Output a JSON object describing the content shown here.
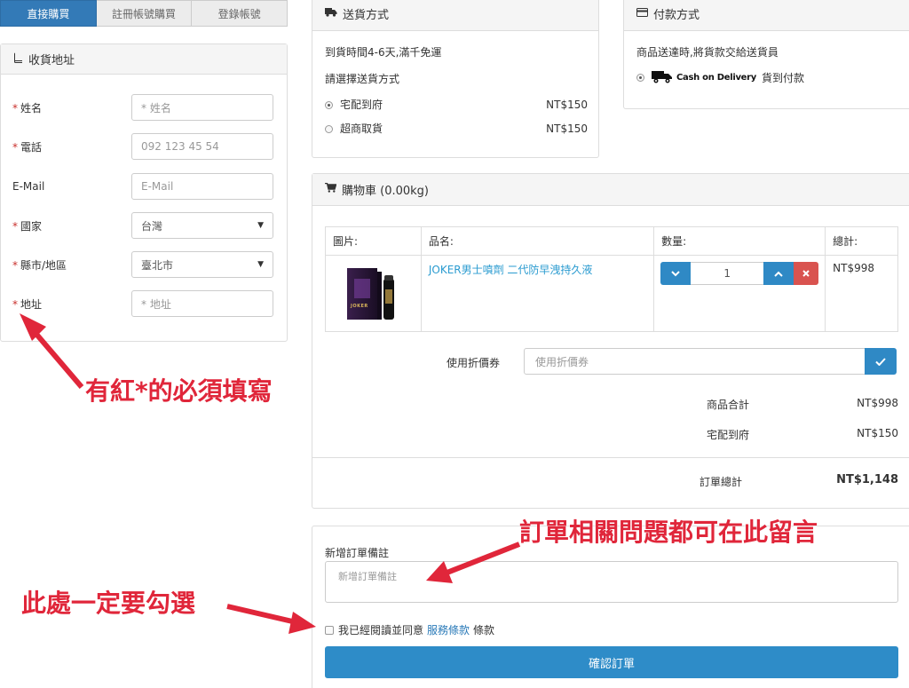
{
  "tabs": [
    {
      "label": "直接購買"
    },
    {
      "label": "註冊帳號購買"
    },
    {
      "label": "登錄帳號"
    }
  ],
  "address": {
    "title": "收貨地址",
    "fields": [
      {
        "label": "姓名",
        "required": true,
        "placeholder": "* 姓名"
      },
      {
        "label": "電話",
        "required": true,
        "placeholder": "092 123 45 54"
      },
      {
        "label": "E-Mail",
        "required": false,
        "placeholder": "E-Mail"
      },
      {
        "label": "國家",
        "required": true,
        "value": "台灣"
      },
      {
        "label": "縣市/地區",
        "required": true,
        "value": "臺北市"
      },
      {
        "label": "地址",
        "required": true,
        "placeholder": "* 地址"
      }
    ]
  },
  "shipping": {
    "title": "送貨方式",
    "note": "到貨時間4-6天,滿千免運",
    "prompt": "請選擇送貨方式",
    "options": [
      {
        "label": "宅配到府",
        "price": "NT$150",
        "selected": true
      },
      {
        "label": "超商取貨",
        "price": "NT$150",
        "selected": false
      }
    ]
  },
  "payment": {
    "title": "付款方式",
    "note": "商品送達時,將貨款交給送貨員",
    "logo_text": "Cash on Delivery",
    "option_label": "貨到付款"
  },
  "cart": {
    "title": "購物車 (0.00kg)",
    "headers": {
      "image": "圖片:",
      "name": "品名:",
      "qty": "數量:",
      "total": "總計:"
    },
    "item": {
      "name": "JOKER男士噴劑 二代防早洩持久液",
      "qty": "1",
      "total": "NT$998",
      "box_label": "JOKER"
    },
    "coupon_label": "使用折價券",
    "coupon_placeholder": "使用折價券",
    "summary": [
      {
        "label": "商品合計",
        "value": "NT$998"
      },
      {
        "label": "宅配到府",
        "value": "NT$150"
      }
    ],
    "grand_label": "訂單總計",
    "grand_value": "NT$1,148"
  },
  "notes": {
    "label": "新增訂單備註",
    "placeholder": "新增訂單備註"
  },
  "terms": {
    "before": "我已經閱讀並同意",
    "link": "服務條款",
    "after": "條款"
  },
  "confirm_label": "確認訂單",
  "annotations": {
    "required": "有紅*的必須填寫",
    "notes": "訂單相關問題都可在此留言",
    "checkbox": "此處一定要勾選"
  },
  "colors": {
    "primary": "#2f89c5",
    "required": "#c9302c",
    "annotation": "#e0263a",
    "link": "#2a7ab8"
  }
}
